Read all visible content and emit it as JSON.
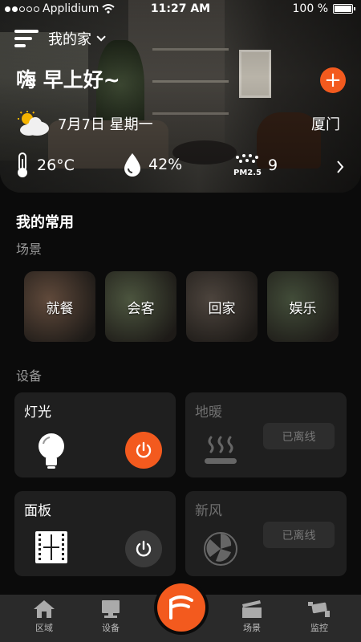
{
  "status_bar": {
    "carrier": "Applidium",
    "time": "11:27 AM",
    "battery": "100 %",
    "battery_level": 1.0
  },
  "header": {
    "home_name": "我的家",
    "greeting": "嗨 早上好~",
    "add_label": "+"
  },
  "weather": {
    "date": "7月7日 星期一",
    "city": "厦门",
    "temperature": "26°C",
    "humidity": "42%",
    "pm25_label": "PM2.5",
    "pm25": "9"
  },
  "favorites": {
    "title": "我的常用",
    "scenes_title": "场景",
    "devices_title": "设备"
  },
  "scenes": [
    {
      "label": "就餐",
      "color": "#8a6a55"
    },
    {
      "label": "会客",
      "color": "#6d7a5a"
    },
    {
      "label": "回家",
      "color": "#6e6258"
    },
    {
      "label": "娱乐",
      "color": "#5f6e52"
    }
  ],
  "devices": [
    {
      "label": "灯光",
      "state": "on",
      "icon": "bulb-icon"
    },
    {
      "label": "地暖",
      "state": "已离线",
      "icon": "floor-heating-icon"
    },
    {
      "label": "面板",
      "state": "idle",
      "icon": "panel-icon"
    },
    {
      "label": "新风",
      "state": "已离线",
      "icon": "fresh-air-icon"
    }
  ],
  "tabs": [
    {
      "label": "区域",
      "icon": "home-icon"
    },
    {
      "label": "设备",
      "icon": "monitor-icon"
    },
    {
      "label": "场景",
      "icon": "clapperboard-icon"
    },
    {
      "label": "监控",
      "icon": "camera-icon"
    }
  ],
  "colors": {
    "accent": "#f35a1e",
    "card": "#1f1f1f",
    "background": "#0b0b0b"
  }
}
